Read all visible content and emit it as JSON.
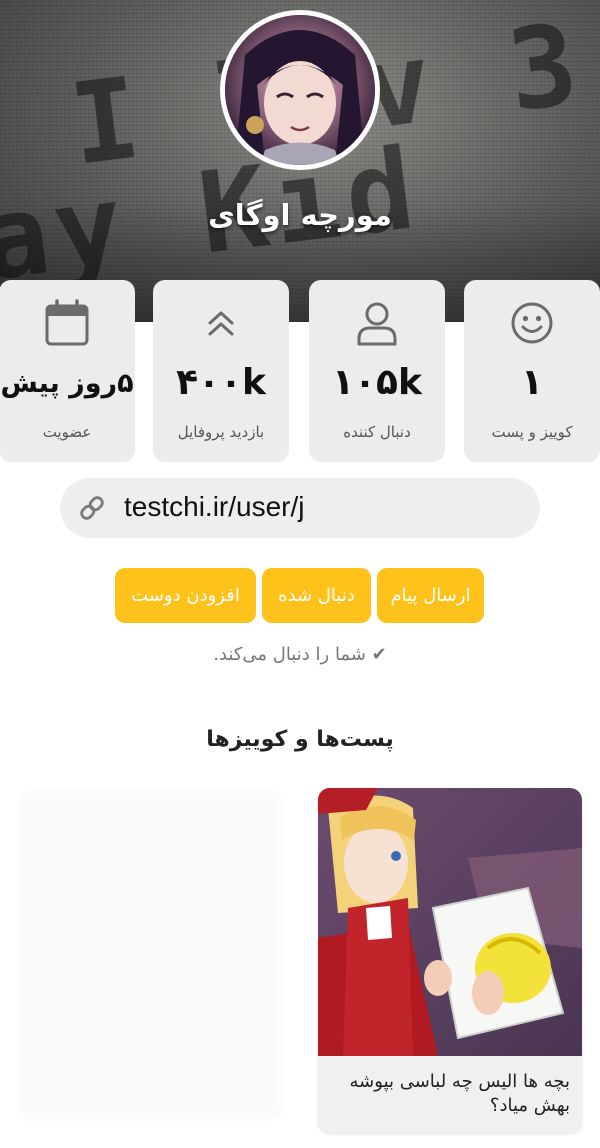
{
  "profile": {
    "username": "مورچه اوگای",
    "banner_text_line1": "I lov  3",
    "banner_text_line2": "ay Kid"
  },
  "stats": [
    {
      "icon": "smile-icon",
      "value": "۱",
      "label": "کوییز و پست"
    },
    {
      "icon": "user-icon",
      "value": "۱۰۵k",
      "label": "دنبال کننده"
    },
    {
      "icon": "chevrons-up-icon",
      "value": "۴۰۰k",
      "label": "بازدید پروفایل"
    },
    {
      "icon": "calendar-icon",
      "value": "۵روز پیش",
      "label": "عضویت"
    }
  ],
  "profile_link": {
    "icon": "link-icon",
    "url": "testchi.ir/user/j"
  },
  "actions": {
    "send_message": "ارسال پیام",
    "followed": "دنبال شده",
    "add_friend": "افزودن دوست"
  },
  "follow_note": "✔ شما را دنبال می‌کند.",
  "section_title": "پست‌ها و کوییزها",
  "posts": [
    {
      "title": "بچه ها الیس چه لباسی بپوشه بهش میاد؟"
    }
  ],
  "colors": {
    "accent": "#ffc21a",
    "card_bg": "#ececec",
    "link_bg": "#eeeeee"
  }
}
